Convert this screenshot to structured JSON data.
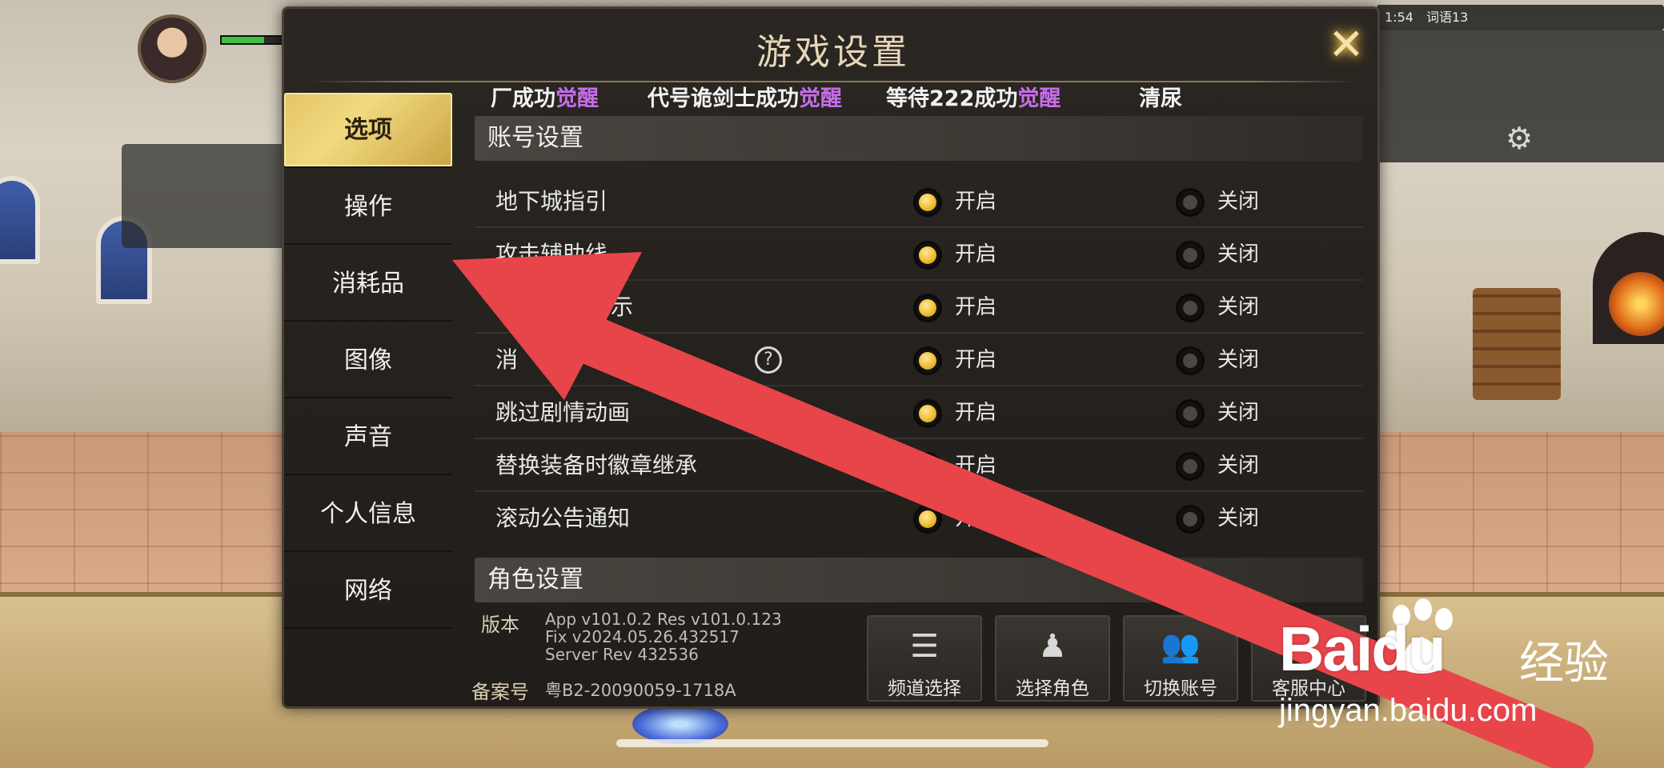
{
  "dialog": {
    "title": "游戏设置"
  },
  "marquee": [
    {
      "prefix": "厂成功",
      "highlight": "觉醒"
    },
    {
      "prefix": "代号诡剑士成功",
      "highlight": "觉醒"
    },
    {
      "prefix": "等待222成功",
      "highlight": "觉醒"
    },
    {
      "prefix": "清尿",
      "highlight": ""
    }
  ],
  "sidebar": {
    "items": [
      {
        "label": "选项",
        "active": true
      },
      {
        "label": "操作",
        "active": false
      },
      {
        "label": "消耗品",
        "active": false
      },
      {
        "label": "图像",
        "active": false
      },
      {
        "label": "声音",
        "active": false
      },
      {
        "label": "个人信息",
        "active": false
      },
      {
        "label": "网络",
        "active": false
      }
    ]
  },
  "account_section": {
    "title": "账号设置",
    "on_label": "开启",
    "off_label": "关闭",
    "rows": [
      {
        "label": "地下城指引",
        "value": "on"
      },
      {
        "label": "攻击辅助线",
        "value": "on"
      },
      {
        "label": "示",
        "value": "on"
      },
      {
        "label": "消",
        "value": "on"
      },
      {
        "label": "跳过剧情动画",
        "value": "on"
      },
      {
        "label": "替换装备时徽章继承",
        "value": "on"
      },
      {
        "label": "滚动公告通知",
        "value": "on"
      }
    ]
  },
  "character_section": {
    "title": "角色设置"
  },
  "footer": {
    "version_label": "版本",
    "version_lines": [
      "App v101.0.2 Res v101.0.123",
      "Fix v2024.05.26.432517",
      "Server Rev 432536"
    ],
    "record_label": "备案号",
    "record_value": "粤B2-20090059-1718A",
    "buttons": [
      {
        "label": "频道选择",
        "icon": "list-icon"
      },
      {
        "label": "选择角色",
        "icon": "character-icon"
      },
      {
        "label": "切换账号",
        "icon": "users-icon"
      },
      {
        "label": "客服中心",
        "icon": "headset-icon"
      }
    ]
  },
  "hud": {
    "top_bar_texts": [
      "1:54",
      "词语13"
    ]
  },
  "watermark": {
    "brand": "Bai",
    "brand_du": "du",
    "product": "经验",
    "url": "jingyan.baidu.com"
  },
  "colors": {
    "accent_gold": "#f2c23b",
    "highlight_purple": "#c66ee8",
    "annotation_red": "#e8454a"
  }
}
